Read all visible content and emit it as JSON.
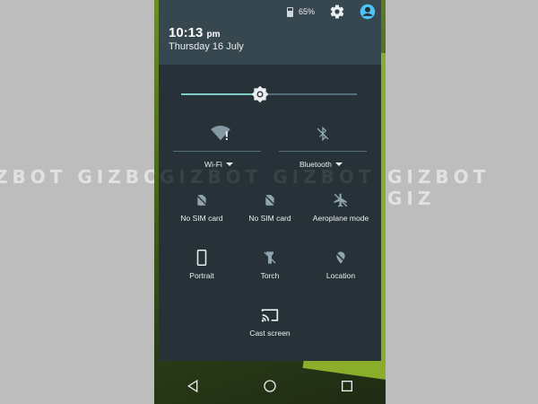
{
  "watermark": {
    "left": "ZBOT  GIZBOT",
    "right": "GIZBOT  GIZ",
    "center": "GIZBOT  GIZBOT"
  },
  "status": {
    "battery_percent_text": "65%",
    "battery_level": 0.65,
    "settings_icon": "gear-icon",
    "user_icon": "account-circle-icon"
  },
  "clock": {
    "time": "10:13",
    "ampm": "pm",
    "date": "Thursday 16 July"
  },
  "brightness": {
    "level": 0.45
  },
  "dual_tiles": [
    {
      "label": "Wi-Fi",
      "icon": "wifi-alert-icon"
    },
    {
      "label": "Bluetooth",
      "icon": "bluetooth-off-icon"
    }
  ],
  "tiles": [
    {
      "label": "No SIM card",
      "icon": "no-sim-icon"
    },
    {
      "label": "No SIM card",
      "icon": "no-sim-icon"
    },
    {
      "label": "Aeroplane mode",
      "icon": "airplane-off-icon"
    },
    {
      "label": "Portrait",
      "icon": "portrait-phone-icon"
    },
    {
      "label": "Torch",
      "icon": "torch-off-icon"
    },
    {
      "label": "Location",
      "icon": "location-off-icon"
    },
    {
      "label": "Cast screen",
      "icon": "cast-icon"
    }
  ],
  "navigation": {
    "back_icon": "back-triangle-icon",
    "home_icon": "home-circle-icon",
    "recents_icon": "recents-square-icon"
  },
  "colors": {
    "panel": "#263238",
    "header": "#37474f",
    "accent": "#80cbc4",
    "text": "#eceff1"
  }
}
